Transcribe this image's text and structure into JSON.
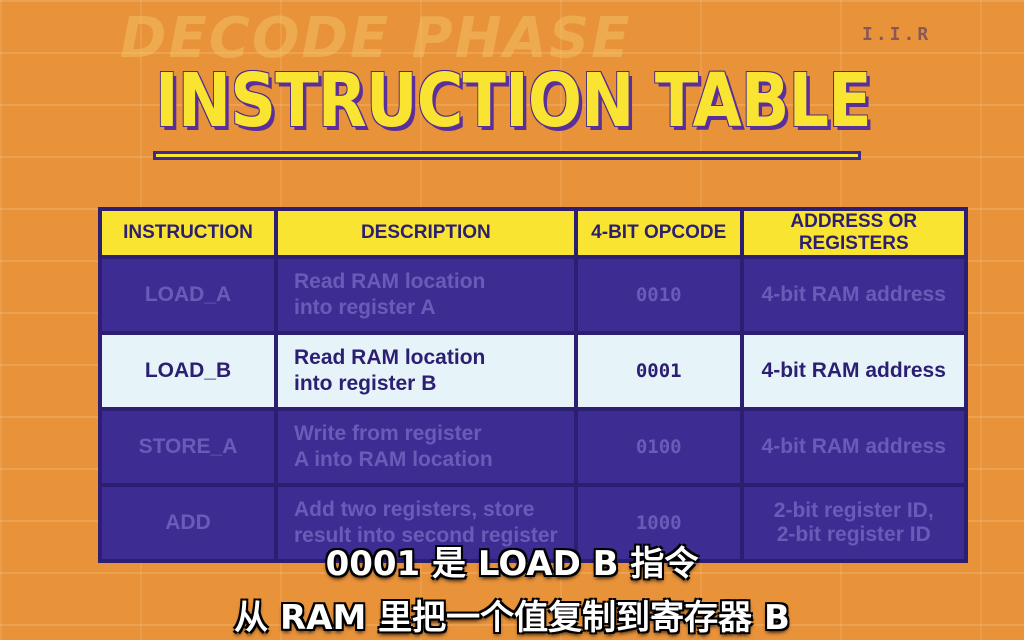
{
  "background": {
    "faded_title": "DECODE PHASE",
    "faded_tag": "I.I.R"
  },
  "title": "INSTRUCTION TABLE",
  "table": {
    "headers": [
      "INSTRUCTION",
      "DESCRIPTION",
      "4-BIT OPCODE",
      "ADDRESS OR REGISTERS"
    ],
    "rows": [
      {
        "instruction": "LOAD_A",
        "desc1": "Read RAM location",
        "desc2": "into register A",
        "opcode": "0010",
        "addr1": "4-bit RAM address",
        "addr2": "",
        "highlighted": false
      },
      {
        "instruction": "LOAD_B",
        "desc1": "Read RAM location",
        "desc2": "into register B",
        "opcode": "0001",
        "addr1": "4-bit RAM address",
        "addr2": "",
        "highlighted": true
      },
      {
        "instruction": "STORE_A",
        "desc1": "Write from register",
        "desc2": "A into RAM location",
        "opcode": "0100",
        "addr1": "4-bit RAM address",
        "addr2": "",
        "highlighted": false
      },
      {
        "instruction": "ADD",
        "desc1": "Add two registers, store",
        "desc2": "result into second register",
        "opcode": "1000",
        "addr1": "2-bit register ID,",
        "addr2": "2-bit register ID",
        "highlighted": false
      }
    ]
  },
  "subtitles": {
    "line1": "0001 是 LOAD B 指令",
    "line2": "从 RAM 里把一个值复制到寄存器 B"
  },
  "colors": {
    "background": "#e8923a",
    "accent_yellow": "#f9e531",
    "table_purple": "#3d2d92",
    "highlight_row": "#e6f4fa"
  }
}
